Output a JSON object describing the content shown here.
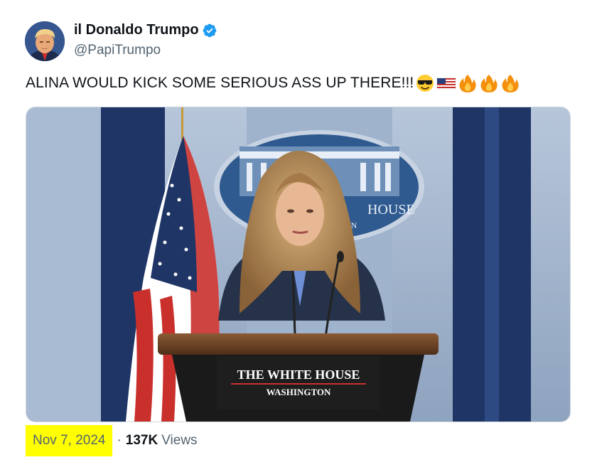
{
  "author": {
    "display_name": "il Donaldo Trumpo",
    "handle": "@PapiTrumpo",
    "verified": true,
    "avatar_icon": "avatar-portrait"
  },
  "tweet": {
    "text": "ALINA WOULD KICK SOME SERIOUS ASS UP THERE!!!",
    "emojis": [
      "smiling-face-with-sunglasses",
      "us-flag",
      "fire",
      "fire",
      "fire"
    ]
  },
  "media": {
    "description_icon": "press-briefing-photo",
    "podium_title": "THE WHITE HOUSE",
    "podium_subtitle": "WASHINGTON",
    "seal_text": "HOUSE",
    "seal_subtext": "ON"
  },
  "meta": {
    "date": "Nov 7, 2024",
    "separator": "·",
    "views_count": "137K",
    "views_label": "Views"
  },
  "colors": {
    "verified_blue": "#1d9bf0",
    "highlight": "#ffff00",
    "text_primary": "#0f1419",
    "text_secondary": "#536471"
  }
}
